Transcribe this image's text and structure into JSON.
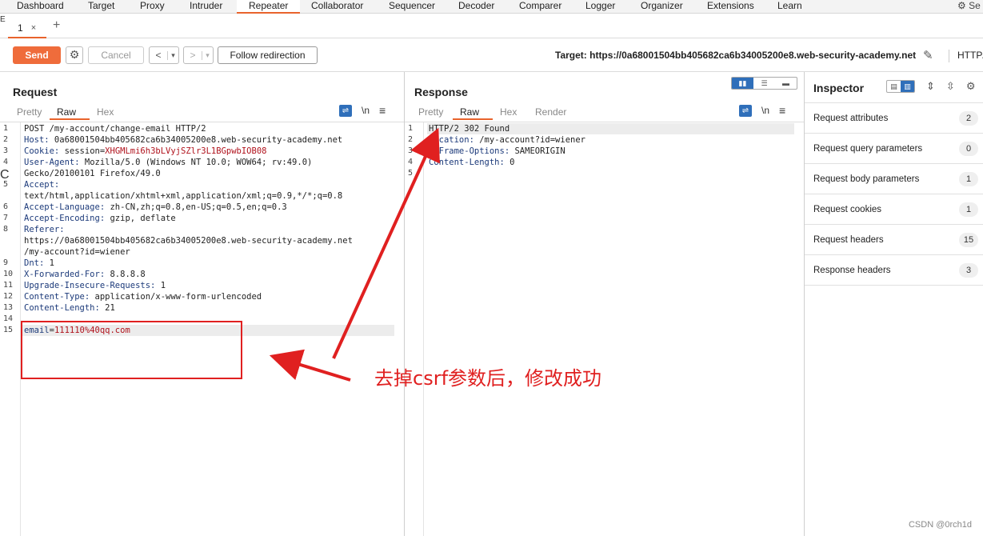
{
  "topnav": {
    "tabs": [
      "Dashboard",
      "Target",
      "Proxy",
      "Intruder",
      "Repeater",
      "Collaborator",
      "Sequencer",
      "Decoder",
      "Comparer",
      "Logger",
      "Organizer",
      "Extensions",
      "Learn"
    ],
    "active": "Repeater",
    "settings_label": "Se"
  },
  "subtabs": {
    "tab_label": "1",
    "close": "×",
    "add": "+"
  },
  "toolbar": {
    "send_label": "Send",
    "cancel_label": "Cancel",
    "back_label": "<",
    "forward_label": ">",
    "dropdown": "▾",
    "follow_label": "Follow redirection",
    "target_label": "Target: https://0a68001504bb405682ca6b34005200e8.web-security-academy.net",
    "http_label": "HTTP/"
  },
  "request": {
    "title": "Request",
    "view_tabs": [
      "Pretty",
      "Raw",
      "Hex"
    ],
    "active_tab": "Raw",
    "newline_label": "\\n",
    "menu_label": "≡",
    "lines": [
      {
        "n": "1",
        "key": "",
        "val": "POST /my-account/change-email HTTP/2"
      },
      {
        "n": "2",
        "key": "Host:",
        "val": " 0a68001504bb405682ca6b34005200e8.web-security-academy.net"
      },
      {
        "n": "3",
        "key": "Cookie:",
        "val": " session=",
        "red": "XHGMLmi6h3bLVyjSZlr3L1BGpwbIOB08"
      },
      {
        "n": "4",
        "key": "User-Agent:",
        "val": " Mozilla/5.0 (Windows NT 10.0; WOW64; rv:49.0)"
      },
      {
        "n": "",
        "key": "",
        "val": "Gecko/20100101 Firefox/49.0"
      },
      {
        "n": "5",
        "key": "Accept:",
        "val": ""
      },
      {
        "n": "",
        "key": "",
        "val": "text/html,application/xhtml+xml,application/xml;q=0.9,*/*;q=0.8"
      },
      {
        "n": "6",
        "key": "Accept-Language:",
        "val": " zh-CN,zh;q=0.8,en-US;q=0.5,en;q=0.3"
      },
      {
        "n": "7",
        "key": "Accept-Encoding:",
        "val": " gzip, deflate"
      },
      {
        "n": "8",
        "key": "Referer:",
        "val": ""
      },
      {
        "n": "",
        "key": "",
        "val": "https://0a68001504bb405682ca6b34005200e8.web-security-academy.net"
      },
      {
        "n": "",
        "key": "",
        "val": "/my-account?id=wiener"
      },
      {
        "n": "9",
        "key": "Dnt:",
        "val": " 1"
      },
      {
        "n": "10",
        "key": "X-Forwarded-For:",
        "val": " 8.8.8.8"
      },
      {
        "n": "11",
        "key": "Upgrade-Insecure-Requests:",
        "val": " 1"
      },
      {
        "n": "12",
        "key": "Content-Type:",
        "val": " application/x-www-form-urlencoded"
      },
      {
        "n": "13",
        "key": "Content-Length:",
        "val": " 21"
      },
      {
        "n": "14",
        "key": "",
        "val": ""
      },
      {
        "n": "15",
        "key": "email",
        "val": "=",
        "red": "111110%40qq.com",
        "hl": true
      }
    ]
  },
  "response": {
    "title": "Response",
    "view_tabs": [
      "Pretty",
      "Raw",
      "Hex",
      "Render"
    ],
    "active_tab": "Raw",
    "newline_label": "\\n",
    "menu_label": "≡",
    "lines": [
      {
        "n": "1",
        "key": "",
        "val": "HTTP/2 302 Found",
        "hl": true
      },
      {
        "n": "2",
        "key": "Location:",
        "val": " /my-account?id=wiener"
      },
      {
        "n": "3",
        "key": "X-Frame-Options:",
        "val": " SAMEORIGIN"
      },
      {
        "n": "4",
        "key": "Content-Length:",
        "val": " 0"
      },
      {
        "n": "5",
        "key": "",
        "val": ""
      }
    ]
  },
  "inspector": {
    "title": "Inspector",
    "rows": [
      {
        "label": "Request attributes",
        "count": "2"
      },
      {
        "label": "Request query parameters",
        "count": "0"
      },
      {
        "label": "Request body parameters",
        "count": "1"
      },
      {
        "label": "Request cookies",
        "count": "1"
      },
      {
        "label": "Request headers",
        "count": "15"
      },
      {
        "label": "Response headers",
        "count": "3"
      }
    ]
  },
  "annotation": {
    "text": "去掉csrf参数后，修改成功",
    "color": "#e02020"
  },
  "watermark": "CSDN @0rch1d",
  "colors": {
    "accent": "#e8632c",
    "send": "#ef6c3b",
    "toggle": "#2f6fba",
    "header_key": "#1c3a7a",
    "value_red": "#b0121c"
  }
}
